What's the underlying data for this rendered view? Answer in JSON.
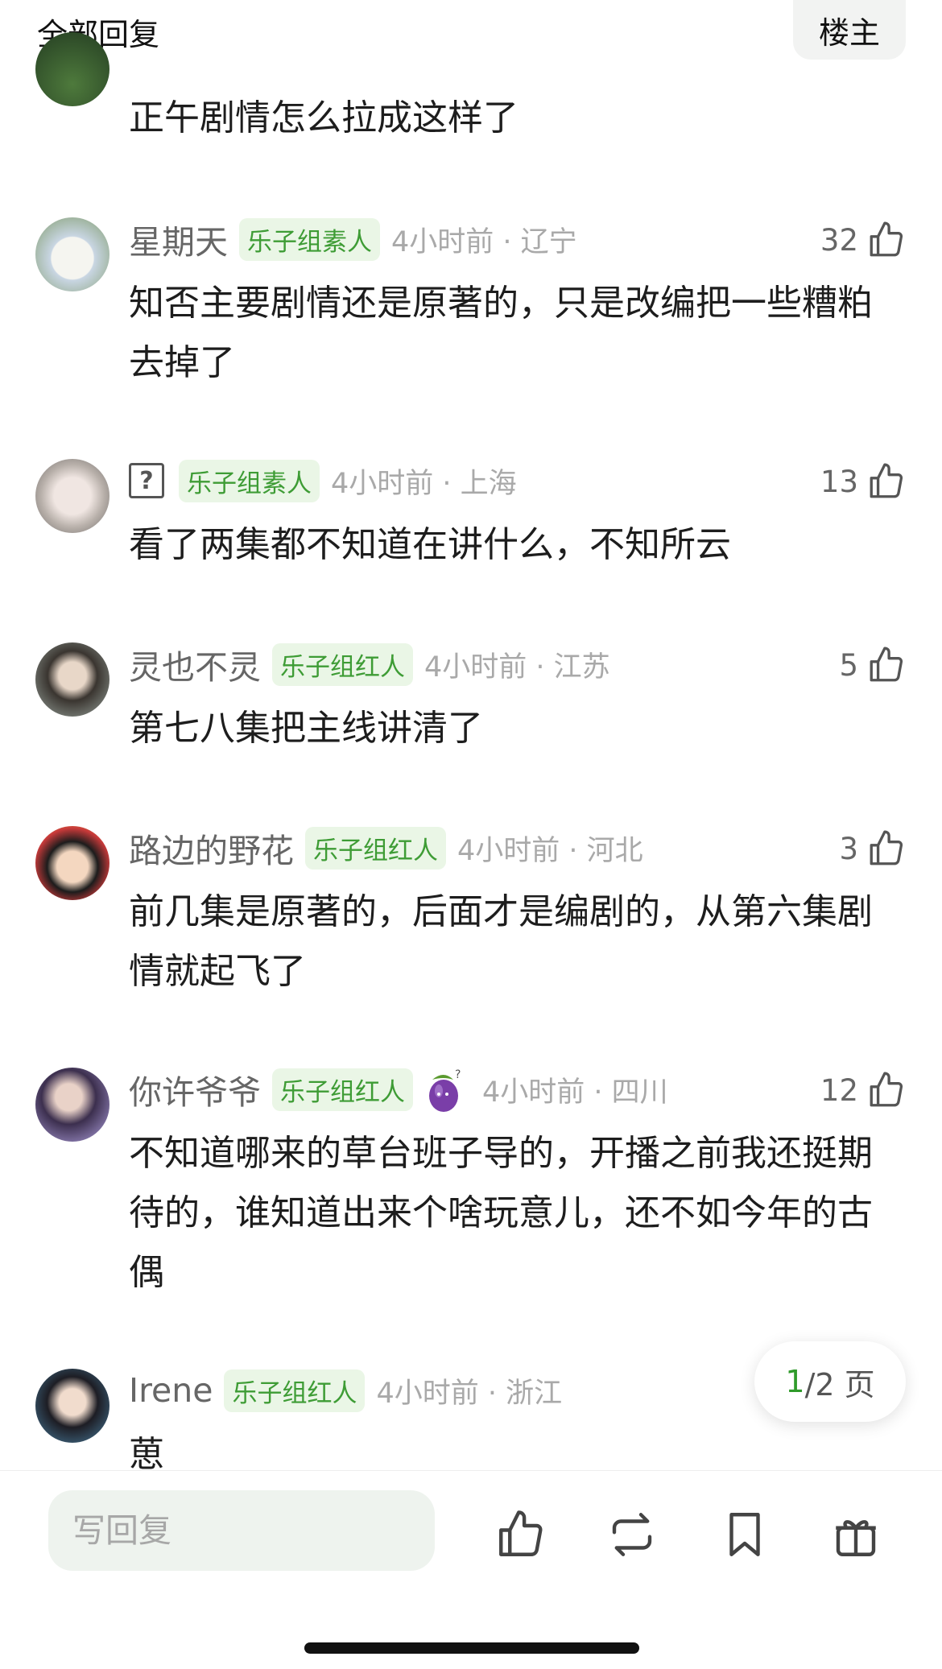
{
  "header": {
    "title": "全部回复",
    "op_label": "楼主"
  },
  "comments": [
    {
      "username": "",
      "badge": "",
      "time": "",
      "likes": "",
      "text": "正午剧情怎么拉成这样了"
    },
    {
      "username": "星期天",
      "badge": "乐子组素人",
      "time": "4小时前 · 辽宁",
      "likes": "32",
      "text": "知否主要剧情还是原著的，只是改编把一些糟粕去掉了"
    },
    {
      "username": "",
      "badge": "乐子组素人",
      "time": "4小时前 · 上海",
      "likes": "13",
      "text": "看了两集都不知道在讲什么，不知所云"
    },
    {
      "username": "灵也不灵",
      "badge": "乐子组红人",
      "time": "4小时前 · 江苏",
      "likes": "5",
      "text": "第七八集把主线讲清了"
    },
    {
      "username": "路边的野花",
      "badge": "乐子组红人",
      "time": "4小时前 · 河北",
      "likes": "3",
      "text": "前几集是原著的，后面才是编剧的，从第六集剧情就起飞了"
    },
    {
      "username": "你许爷爷",
      "badge": "乐子组红人",
      "time": "4小时前 · 四川",
      "likes": "12",
      "text": "不知道哪来的草台班子导的，开播之前我还挺期待的，谁知道出来个啥玩意儿，还不如今年的古偶"
    },
    {
      "username": "Irene",
      "badge": "乐子组红人",
      "time": "4小时前 · 浙江",
      "likes": "",
      "text": "葸"
    }
  ],
  "pagination": {
    "current": "1",
    "total": "/2 页"
  },
  "bottom_bar": {
    "reply_placeholder": "写回复"
  },
  "colors": {
    "accent_green": "#3e9c35",
    "badge_bg": "#eaf6e6"
  },
  "icons": [
    "thumbs-up-icon",
    "repost-icon",
    "bookmark-icon",
    "gift-icon",
    "unknown-avatar-icon",
    "eggplant-icon"
  ]
}
